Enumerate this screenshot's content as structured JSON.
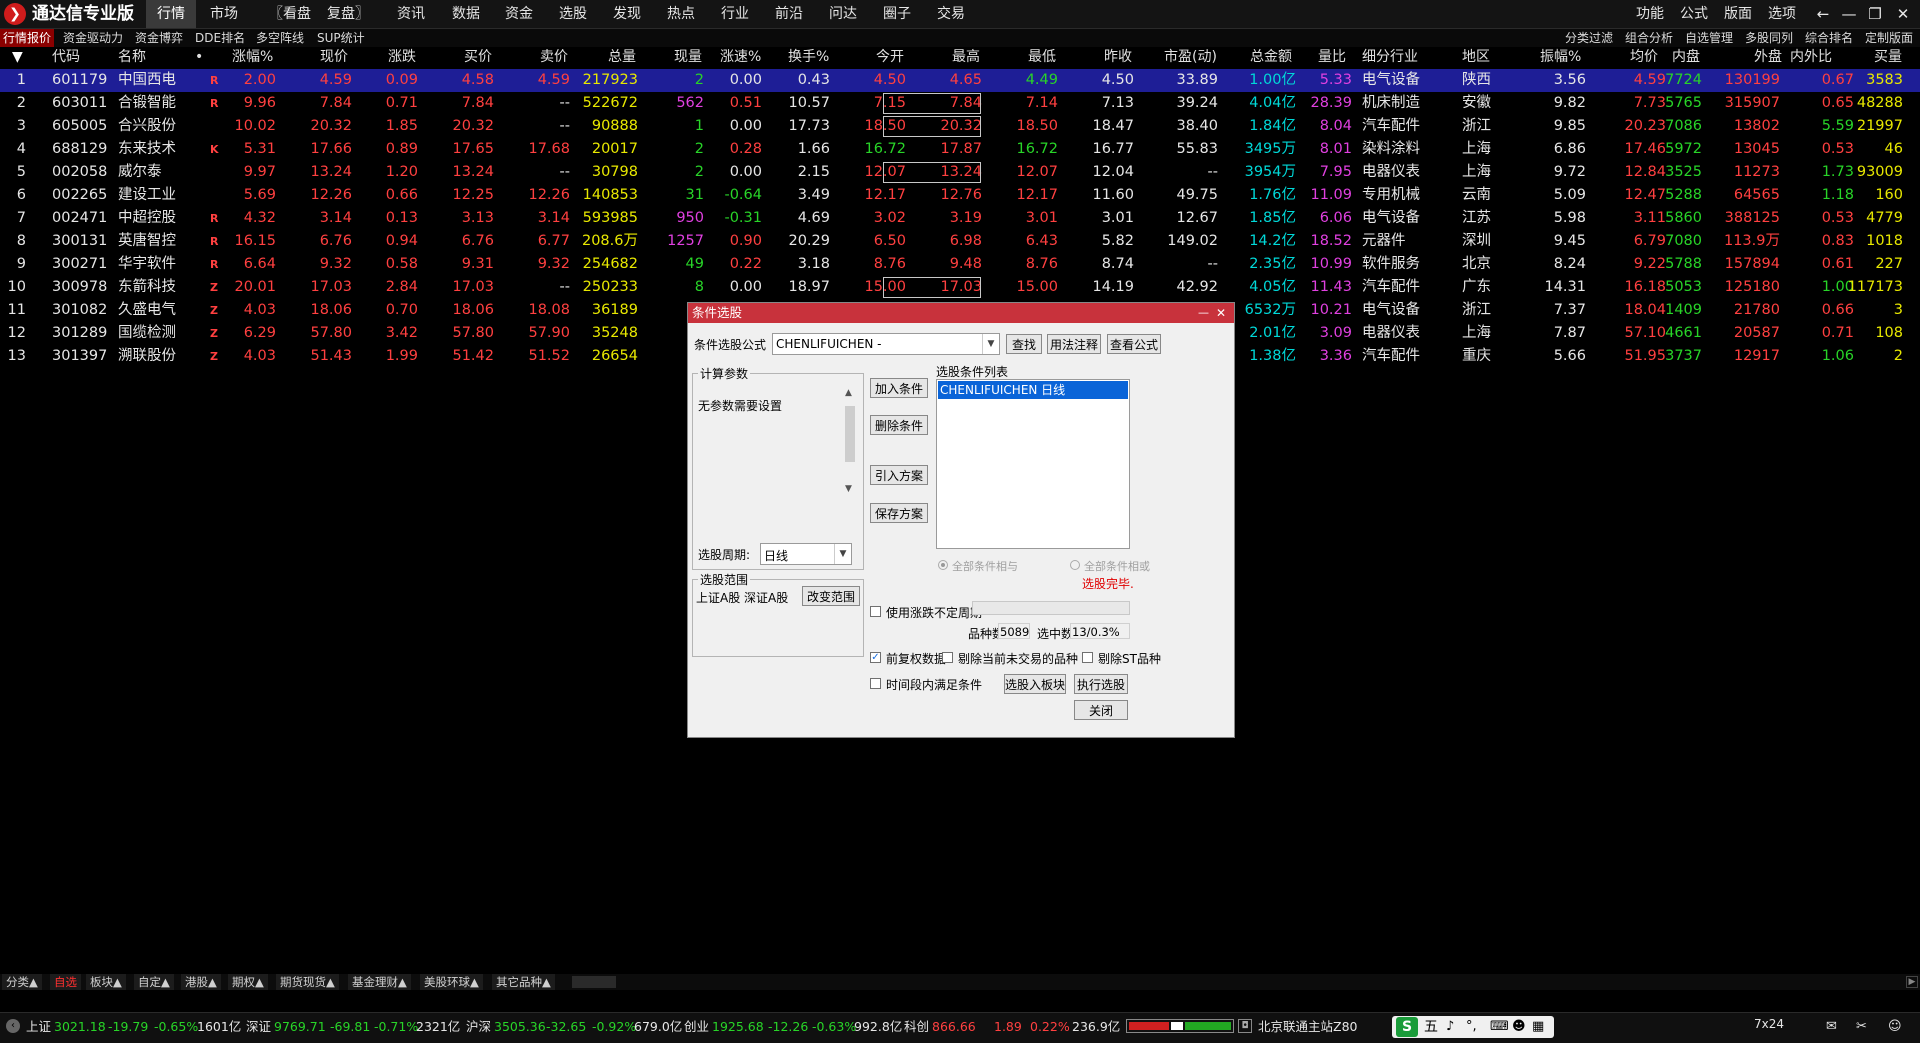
{
  "app": {
    "title": "通达信专业版",
    "logo": "logo-icon"
  },
  "menu": [
    "行情",
    "市场",
    "〖看盘",
    "复盘〗",
    "资讯",
    "数据",
    "资金",
    "选股",
    "发现",
    "热点",
    "行业",
    "前沿",
    "问达",
    "圈子",
    "交易"
  ],
  "right_menu": [
    "功能",
    "公式",
    "版面",
    "选项"
  ],
  "sub_tabs": [
    "行情报价",
    "资金驱动力",
    "资金博弈",
    "DDE排名",
    "多空阵线",
    "SUP统计"
  ],
  "right_sub_tabs": [
    "分类过滤",
    "组合分析",
    "自选管理",
    "多股同列",
    "综合排名",
    "定制版面"
  ],
  "columns": [
    "代码",
    "名称",
    "•",
    "涨幅%",
    "现价",
    "涨跌",
    "买价",
    "卖价",
    "总量",
    "现量",
    "涨速%",
    "换手%",
    "今开",
    "最高",
    "最低",
    "昨收",
    "市盈(动)",
    "总金额",
    "量比",
    "细分行业",
    "地区",
    "振幅%",
    "均价",
    "内盘",
    "外盘",
    "内外比",
    "买量"
  ],
  "rows": [
    {
      "n": "1",
      "code": "601179",
      "name": "中国西电",
      "f": "R",
      "chg": "2.00",
      "price": "4.59",
      "diff": "0.09",
      "bid": "4.58",
      "ask": "4.59",
      "vol": "217923",
      "cur": "2",
      "spd": "0.00",
      "turn": "0.43",
      "open": "4.50",
      "high": "4.65",
      "low": "4.49",
      "prev": "4.50",
      "pe": "33.89",
      "amt": "1.00亿",
      "vr": "5.33",
      "ind": "电气设备",
      "reg": "陕西",
      "amp": "3.56",
      "avg": "4.59",
      "inn": "7724",
      "out": "130199",
      "io": "0.67",
      "bq": "3583"
    },
    {
      "n": "2",
      "code": "603011",
      "name": "合锻智能",
      "f": "R",
      "chg": "9.96",
      "price": "7.84",
      "diff": "0.71",
      "bid": "7.84",
      "ask": "--",
      "vol": "522672",
      "cur": "562",
      "spd": "0.51",
      "turn": "10.57",
      "open": "7.15",
      "high": "7.84",
      "low": "7.14",
      "prev": "7.13",
      "pe": "39.24",
      "amt": "4.04亿",
      "vr": "28.39",
      "ind": "机床制造",
      "reg": "安徽",
      "amp": "9.82",
      "avg": "7.73",
      "inn": "5765",
      "out": "315907",
      "io": "0.65",
      "bq": "48288"
    },
    {
      "n": "3",
      "code": "605005",
      "name": "合兴股份",
      "f": "",
      "chg": "10.02",
      "price": "20.32",
      "diff": "1.85",
      "bid": "20.32",
      "ask": "--",
      "vol": "90888",
      "cur": "1",
      "spd": "0.00",
      "turn": "17.73",
      "open": "18.50",
      "high": "20.32",
      "low": "18.50",
      "prev": "18.47",
      "pe": "38.40",
      "amt": "1.84亿",
      "vr": "8.04",
      "ind": "汽车配件",
      "reg": "浙江",
      "amp": "9.85",
      "avg": "20.23",
      "inn": "7086",
      "out": "13802",
      "io": "5.59",
      "bq": "21997"
    },
    {
      "n": "4",
      "code": "688129",
      "name": "东来技术",
      "f": "K",
      "chg": "5.31",
      "price": "17.66",
      "diff": "0.89",
      "bid": "17.65",
      "ask": "17.68",
      "vol": "20017",
      "cur": "2",
      "spd": "0.28",
      "turn": "1.66",
      "open": "16.72",
      "high": "17.87",
      "low": "16.72",
      "prev": "16.77",
      "pe": "55.83",
      "amt": "3495万",
      "vr": "8.01",
      "ind": "染料涂料",
      "reg": "上海",
      "amp": "6.86",
      "avg": "17.46",
      "inn": "5972",
      "out": "13045",
      "io": "0.53",
      "bq": "46"
    },
    {
      "n": "5",
      "code": "002058",
      "name": "威尔泰",
      "f": "",
      "chg": "9.97",
      "price": "13.24",
      "diff": "1.20",
      "bid": "13.24",
      "ask": "--",
      "vol": "30798",
      "cur": "2",
      "spd": "0.00",
      "turn": "2.15",
      "open": "12.07",
      "high": "13.24",
      "low": "12.07",
      "prev": "12.04",
      "pe": "--",
      "amt": "3954万",
      "vr": "7.95",
      "ind": "电器仪表",
      "reg": "上海",
      "amp": "9.72",
      "avg": "12.84",
      "inn": "3525",
      "out": "11273",
      "io": "1.73",
      "bq": "93009"
    },
    {
      "n": "6",
      "code": "002265",
      "name": "建设工业",
      "f": "",
      "chg": "5.69",
      "price": "12.26",
      "diff": "0.66",
      "bid": "12.25",
      "ask": "12.26",
      "vol": "140853",
      "cur": "31",
      "spd": "-0.64",
      "turn": "3.49",
      "open": "12.17",
      "high": "12.76",
      "low": "12.17",
      "prev": "11.60",
      "pe": "49.75",
      "amt": "1.76亿",
      "vr": "11.09",
      "ind": "专用机械",
      "reg": "云南",
      "amp": "5.09",
      "avg": "12.47",
      "inn": "5288",
      "out": "64565",
      "io": "1.18",
      "bq": "160"
    },
    {
      "n": "7",
      "code": "002471",
      "name": "中超控股",
      "f": "R",
      "chg": "4.32",
      "price": "3.14",
      "diff": "0.13",
      "bid": "3.13",
      "ask": "3.14",
      "vol": "593985",
      "cur": "950",
      "spd": "-0.31",
      "turn": "4.69",
      "open": "3.02",
      "high": "3.19",
      "low": "3.01",
      "prev": "3.01",
      "pe": "12.67",
      "amt": "1.85亿",
      "vr": "6.06",
      "ind": "电气设备",
      "reg": "江苏",
      "amp": "5.98",
      "avg": "3.11",
      "inn": "5860",
      "out": "388125",
      "io": "0.53",
      "bq": "4779"
    },
    {
      "n": "8",
      "code": "300131",
      "name": "英唐智控",
      "f": "R",
      "chg": "16.15",
      "price": "6.76",
      "diff": "0.94",
      "bid": "6.76",
      "ask": "6.77",
      "vol": "208.6万",
      "cur": "1257",
      "spd": "0.90",
      "turn": "20.29",
      "open": "6.50",
      "high": "6.98",
      "low": "6.43",
      "prev": "5.82",
      "pe": "149.02",
      "amt": "14.2亿",
      "vr": "18.52",
      "ind": "元器件",
      "reg": "深圳",
      "amp": "9.45",
      "avg": "6.79",
      "inn": "7080",
      "out": "113.9万",
      "io": "0.83",
      "bq": "1018"
    },
    {
      "n": "9",
      "code": "300271",
      "name": "华宇软件",
      "f": "R",
      "chg": "6.64",
      "price": "9.32",
      "diff": "0.58",
      "bid": "9.31",
      "ask": "9.32",
      "vol": "254682",
      "cur": "49",
      "spd": "0.22",
      "turn": "3.18",
      "open": "8.76",
      "high": "9.48",
      "low": "8.76",
      "prev": "8.74",
      "pe": "--",
      "amt": "2.35亿",
      "vr": "10.99",
      "ind": "软件服务",
      "reg": "北京",
      "amp": "8.24",
      "avg": "9.22",
      "inn": "5788",
      "out": "157894",
      "io": "0.61",
      "bq": "227"
    },
    {
      "n": "10",
      "code": "300978",
      "name": "东箭科技",
      "f": "Z",
      "chg": "20.01",
      "price": "17.03",
      "diff": "2.84",
      "bid": "17.03",
      "ask": "--",
      "vol": "250233",
      "cur": "8",
      "spd": "0.00",
      "turn": "18.97",
      "open": "15.00",
      "high": "17.03",
      "low": "15.00",
      "prev": "14.19",
      "pe": "42.92",
      "amt": "4.05亿",
      "vr": "11.43",
      "ind": "汽车配件",
      "reg": "广东",
      "amp": "14.31",
      "avg": "16.18",
      "inn": "5053",
      "out": "125180",
      "io": "1.00",
      "bq": "117173"
    },
    {
      "n": "11",
      "code": "301082",
      "name": "久盛电气",
      "f": "Z",
      "chg": "4.03",
      "price": "18.06",
      "diff": "0.70",
      "bid": "18.06",
      "ask": "18.08",
      "vol": "36189",
      "cur": "",
      "spd": "",
      "turn": "",
      "open": "",
      "high": "",
      "low": "",
      "prev": "",
      "pe": "",
      "amt": "6532万",
      "vr": "10.21",
      "ind": "电气设备",
      "reg": "浙江",
      "amp": "7.37",
      "avg": "18.04",
      "inn": "1409",
      "out": "21780",
      "io": "0.66",
      "bq": "3"
    },
    {
      "n": "12",
      "code": "301289",
      "name": "国缆检测",
      "f": "Z",
      "chg": "6.29",
      "price": "57.80",
      "diff": "3.42",
      "bid": "57.80",
      "ask": "57.90",
      "vol": "35248",
      "cur": "",
      "spd": "",
      "turn": "",
      "open": "",
      "high": "",
      "low": "",
      "prev": "",
      "pe": "",
      "amt": "2.01亿",
      "vr": "3.09",
      "ind": "电器仪表",
      "reg": "上海",
      "amp": "7.87",
      "avg": "57.10",
      "inn": "4661",
      "out": "20587",
      "io": "0.71",
      "bq": "108"
    },
    {
      "n": "13",
      "code": "301397",
      "name": "溯联股份",
      "f": "Z",
      "chg": "4.03",
      "price": "51.43",
      "diff": "1.99",
      "bid": "51.42",
      "ask": "51.52",
      "vol": "26654",
      "cur": "",
      "spd": "",
      "turn": "",
      "open": "",
      "high": "",
      "low": "",
      "prev": "",
      "pe": "",
      "amt": "1.38亿",
      "vr": "3.36",
      "ind": "汽车配件",
      "reg": "重庆",
      "amp": "5.66",
      "avg": "51.95",
      "inn": "3737",
      "out": "12917",
      "io": "1.06",
      "bq": "2"
    }
  ],
  "bottom_tabs": [
    "分类▲",
    "自选",
    "板块▲",
    "自定▲",
    "港股▲",
    "期权▲",
    "期货现货▲",
    "基金理财▲",
    "美股环球▲",
    "其它品种▲"
  ],
  "status": {
    "sh": {
      "label": "上证",
      "val": "3021.18",
      "chg": "-19.79",
      "pct": "-0.65%",
      "amt": "1601亿"
    },
    "sz": {
      "label": "深证",
      "val": "9769.71",
      "chg": "-69.81",
      "pct": "-0.71%",
      "amt": "2321亿"
    },
    "hs": {
      "label": "沪深",
      "val": "3505.36",
      "chg": "-32.65",
      "pct": "-0.92%",
      "amt": "679.0亿"
    },
    "cy": {
      "label": "创业",
      "val": "1925.68",
      "chg": "-12.26",
      "pct": "-0.63%",
      "amt": "992.8亿"
    },
    "kc": {
      "label": "科创",
      "val": "866.66",
      "chg": "1.89",
      "pct": "0.22%",
      "amt": "236.9亿"
    },
    "server": "北京联通主站Z80",
    "ime": "五",
    "clock": "7x24"
  },
  "dialog": {
    "title": "条件选股",
    "formula_label": "条件选股公式",
    "formula_value": "CHENLIFUICHEN -",
    "btn_find": "查找",
    "btn_usage": "用法注释",
    "btn_view": "查看公式",
    "params_group": "计算参数",
    "params_text": "无参数需要设置",
    "period_label": "选股周期:",
    "period_value": "日线",
    "range_group": "选股范围",
    "range_text": "上证A股 深证A股",
    "btn_change_range": "改变范围",
    "btn_add": "加入条件",
    "btn_delete": "删除条件",
    "btn_import": "引入方案",
    "btn_save": "保存方案",
    "list_label": "选股条件列表",
    "list_items": [
      "CHENLIFUICHEN  日线"
    ],
    "radio_and": "全部条件相与",
    "radio_or": "全部条件相或",
    "done_text": "选股完毕.",
    "use_period": "使用涨跌不定周期",
    "total_label": "品种数",
    "total_value": "5089",
    "selected_label": "选中数",
    "selected_value": "13/0.3%",
    "cb_fq": "前复权数据",
    "cb_untraded": "剔除当前未交易的品种",
    "cb_st": "剔除ST品种",
    "cb_interval": "时间段内满足条件",
    "btn_to_block": "选股入板块",
    "btn_execute": "执行选股",
    "btn_close": "关闭"
  },
  "colors": {
    "up": "#ff4040",
    "down": "#28d428",
    "selected_row": "#1e1e96",
    "dialog_title": "#c8323c"
  }
}
